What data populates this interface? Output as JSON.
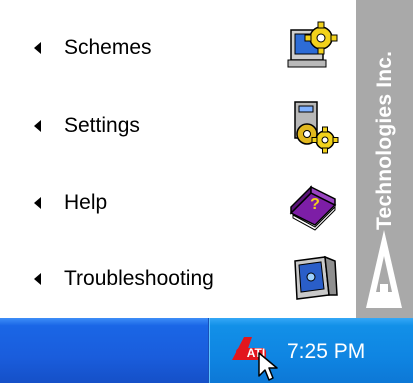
{
  "menu": {
    "items": [
      {
        "label": "Schemes",
        "icon": "schemes-monitor-gear-icon"
      },
      {
        "label": "Settings",
        "icon": "settings-gears-icon"
      },
      {
        "label": "Help",
        "icon": "help-book-icon"
      },
      {
        "label": "Troubleshooting",
        "icon": "troubleshooting-monitor-icon"
      }
    ]
  },
  "brand": {
    "text": "Technologies Inc.",
    "logo_text": "ATI",
    "logo": "ati-logo-icon"
  },
  "taskbar": {
    "tray_icon": "ati-tray-icon",
    "clock": "7:25 PM",
    "cursor": "mouse-pointer-icon"
  },
  "colors": {
    "taskbar_blue": "#1a5ddc",
    "tray_blue": "#0f85e2",
    "brand_strip": "#a9a9a9",
    "ati_red": "#e2161d"
  }
}
